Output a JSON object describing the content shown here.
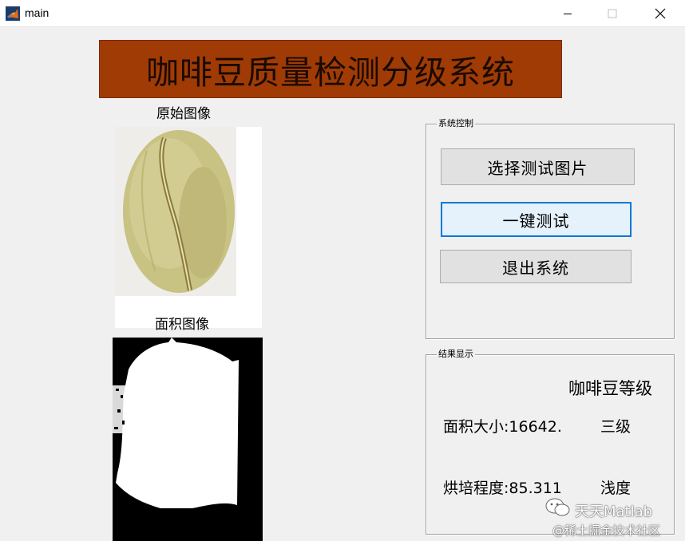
{
  "window": {
    "title": "main"
  },
  "banner": {
    "title": "咖啡豆质量检测分级系统"
  },
  "images": {
    "original_title": "原始图像",
    "area_title": "面积图像"
  },
  "control_panel": {
    "label": "系统控制",
    "select_button": "选择测试图片",
    "test_button": "一键测试",
    "exit_button": "退出系统"
  },
  "result_panel": {
    "label": "结果显示",
    "heading": "咖啡豆等级",
    "area_label": "面积大小:16642.",
    "area_grade": "三级",
    "roast_label": "烘培程度:85.311",
    "roast_grade": "浅度"
  },
  "watermark": {
    "line1": "天天Matlab",
    "line2": "@稀土掘金技术社区"
  },
  "colors": {
    "banner_bg": "#a03b05",
    "focus_border": "#0078d7",
    "window_bg": "#f0f0f0"
  }
}
